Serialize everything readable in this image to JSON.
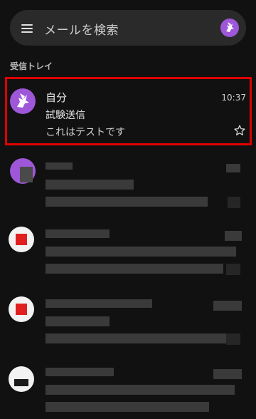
{
  "search": {
    "placeholder": "メールを検索"
  },
  "inbox": {
    "section_label": "受信トレイ"
  },
  "selected_mail": {
    "sender": "自分",
    "subject": "試験送信",
    "snippet": "これはテストです",
    "time": "10:37"
  },
  "colors": {
    "avatar_purple": "#9e57d8",
    "highlight_red": "#e10000",
    "background": "#111111"
  },
  "icons": {
    "menu": "hamburger-icon",
    "star": "star-outline-icon",
    "avatar": "pegasus-icon"
  }
}
